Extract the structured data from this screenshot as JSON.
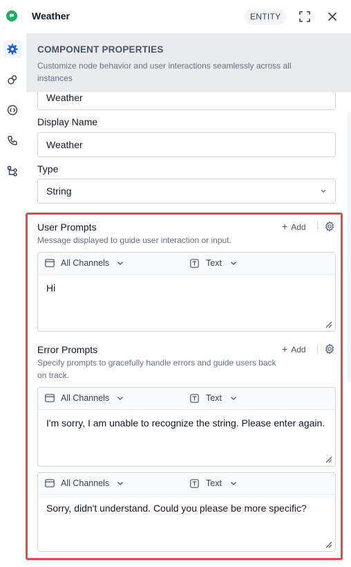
{
  "header": {
    "title": "Weather",
    "badge": "ENTITY"
  },
  "sidebar": {
    "items": [
      {
        "icon": "gear-icon",
        "active": true
      },
      {
        "icon": "link-icon",
        "active": false
      },
      {
        "icon": "code-icon",
        "active": false
      },
      {
        "icon": "phone-icon",
        "active": false
      },
      {
        "icon": "flow-icon",
        "active": false
      }
    ]
  },
  "banner": {
    "title": "COMPONENT PROPERTIES",
    "description": "Customize node behavior and user interactions seamlessly across all instances"
  },
  "form": {
    "name_value": "Weather",
    "display_name_label": "Display Name",
    "display_name_value": "Weather",
    "type_label": "Type",
    "type_value": "String"
  },
  "user_prompts": {
    "title": "User Prompts",
    "description": "Message displayed to guide user interaction or input.",
    "add_label": "Add",
    "items": [
      {
        "channel": "All Channels",
        "format": "Text",
        "text": "Hi"
      }
    ]
  },
  "error_prompts": {
    "title": "Error Prompts",
    "description": "Specify prompts to gracefully handle errors and guide users back on track.",
    "add_label": "Add",
    "items": [
      {
        "channel": "All Channels",
        "format": "Text",
        "text": "I'm sorry, I am unable to recognize the string. Please enter again."
      },
      {
        "channel": "All Channels",
        "format": "Text",
        "text": "Sorry, didn't understand. Could you please be more specific?"
      }
    ]
  },
  "colors": {
    "accent": "#155eef",
    "highlight": "#e5484d",
    "logo": "#16b364"
  }
}
